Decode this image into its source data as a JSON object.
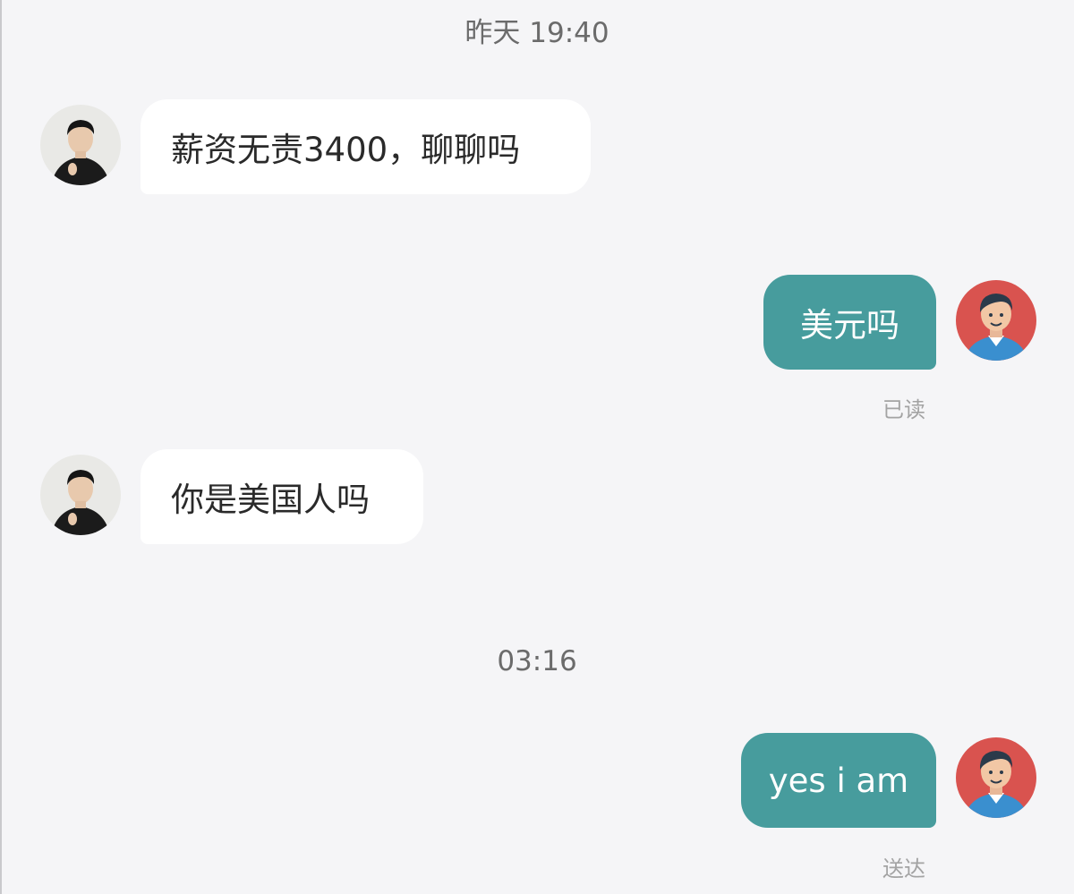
{
  "timestamps": {
    "first": "昨天 19:40",
    "second": "03:16"
  },
  "messages": [
    {
      "direction": "incoming",
      "text": "薪资无责3400，聊聊吗"
    },
    {
      "direction": "outgoing",
      "text": "美元吗",
      "status": "已读"
    },
    {
      "direction": "incoming",
      "text": "你是美国人吗"
    },
    {
      "direction": "outgoing",
      "text": "yes i am",
      "status": "送达"
    }
  ],
  "colors": {
    "background": "#f5f5f7",
    "incoming_bubble": "#ffffff",
    "outgoing_bubble": "#479c9d",
    "self_avatar_bg": "#d9534f"
  },
  "icons": {
    "contact_avatar": "contact-photo-avatar",
    "self_avatar": "cartoon-man-avatar"
  }
}
